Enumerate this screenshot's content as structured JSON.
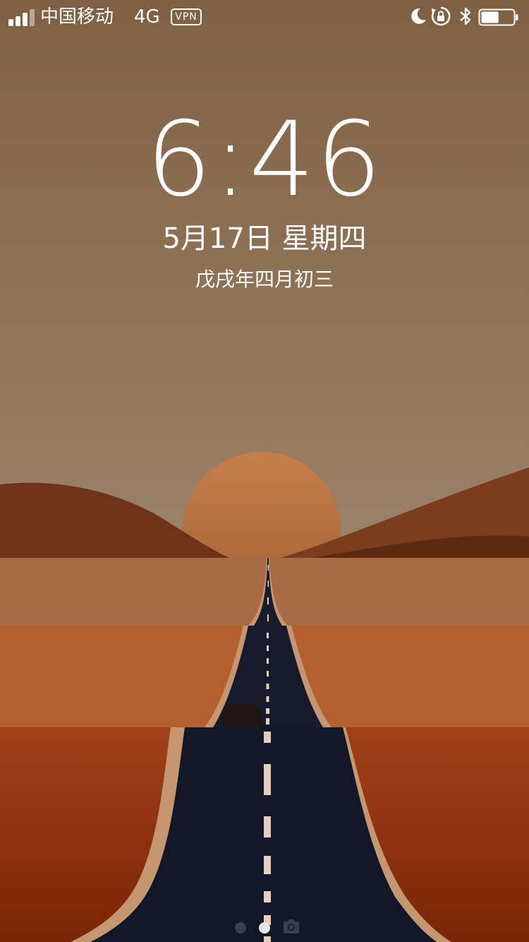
{
  "status_bar": {
    "carrier": "中国移动",
    "network": "4G",
    "vpn": "VPN",
    "icons": [
      "signal-icon",
      "moon-icon",
      "rotation-lock-icon",
      "bluetooth-icon",
      "battery-icon"
    ],
    "battery_level": 0.55
  },
  "lock_screen": {
    "time": "6:46",
    "date": "5月17日 星期四",
    "lunar_date": "戊戌年四月初三"
  },
  "page_indicator": {
    "pages": 2,
    "active_page": 2,
    "camera_icon": "camera-icon"
  },
  "colors": {
    "sky_top": "#7f6043",
    "sky_bottom": "#988068",
    "sun": "#b46a3d",
    "hills": "#6a3318",
    "desert_far": "#a8673f",
    "desert_mid": "#b46234",
    "desert_near": "#962f0b",
    "road": "#141727",
    "road_shoulder": "#c69670"
  }
}
